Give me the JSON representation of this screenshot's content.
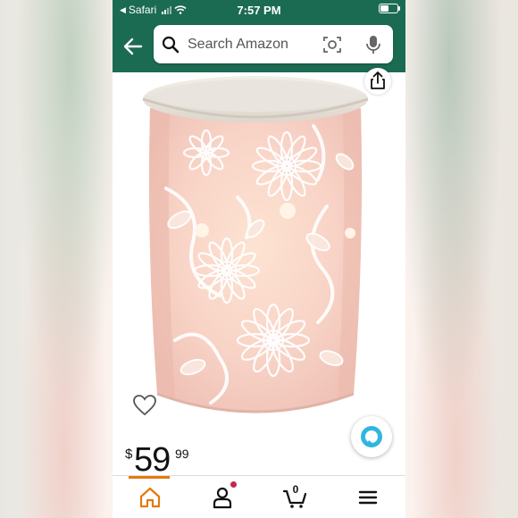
{
  "status_bar": {
    "carrier": "Safari",
    "time": "7:57 PM"
  },
  "header": {
    "search_placeholder": "Search Amazon",
    "theme_color": "#1b6b53"
  },
  "product": {
    "price_currency": "$",
    "price_whole": "59",
    "price_fraction": "99"
  },
  "tab_bar": {
    "cart_count": "0",
    "accent_color": "#e47911"
  },
  "icons": {
    "back": "back-arrow-icon",
    "search": "search-icon",
    "camera": "camera-icon",
    "mic": "microphone-icon",
    "share": "share-icon",
    "wishlist": "heart-icon",
    "assistant": "alexa-icon",
    "home": "home-icon",
    "account": "account-icon",
    "cart": "cart-icon",
    "menu": "menu-icon"
  }
}
